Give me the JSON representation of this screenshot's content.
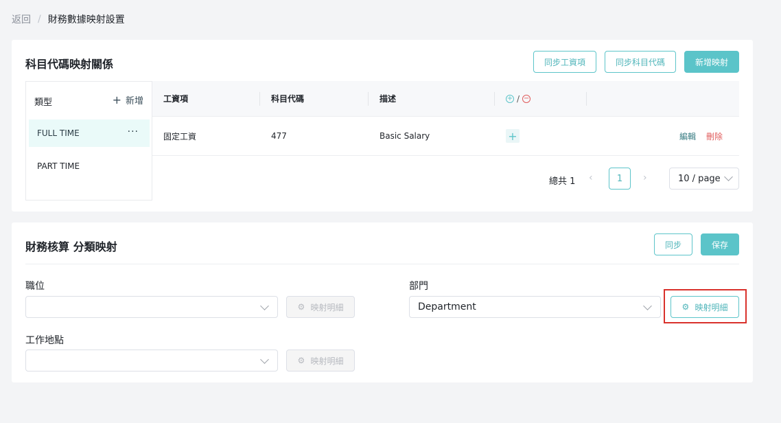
{
  "breadcrumb": {
    "back": "返回",
    "separator": "/",
    "current": "財務數據映射設置"
  },
  "section1": {
    "title": "科目代碼映射關係",
    "buttons": {
      "sync_salary": "同步工資項",
      "sync_code": "同步科目代碼",
      "add_mapping": "新增映射"
    },
    "type_panel": {
      "header": "類型",
      "add_label": "新增",
      "items": [
        {
          "label": "FULL TIME",
          "more": "···"
        },
        {
          "label": "PART TIME"
        }
      ]
    },
    "table": {
      "columns": [
        "工資項",
        "科目代碼",
        "描述"
      ],
      "add_remove_sep": "/",
      "rows": [
        {
          "salary_item": "固定工資",
          "code": "477",
          "description": "Basic Salary",
          "edit": "編輯",
          "delete": "刪除"
        }
      ]
    },
    "pagination": {
      "total": "總共 1",
      "current_page": "1",
      "page_size": "10 / page",
      "prev": "‹",
      "next": "›"
    }
  },
  "section2": {
    "title": "財務核算 分類映射",
    "buttons": {
      "sync": "同步",
      "save": "保存"
    },
    "fields": {
      "position": {
        "label": "職位",
        "value": "",
        "detail_button": "映射明細"
      },
      "department": {
        "label": "部門",
        "value": "Department",
        "detail_button": "映射明細"
      },
      "location": {
        "label": "工作地點",
        "value": "",
        "detail_button": "映射明細"
      }
    }
  }
}
